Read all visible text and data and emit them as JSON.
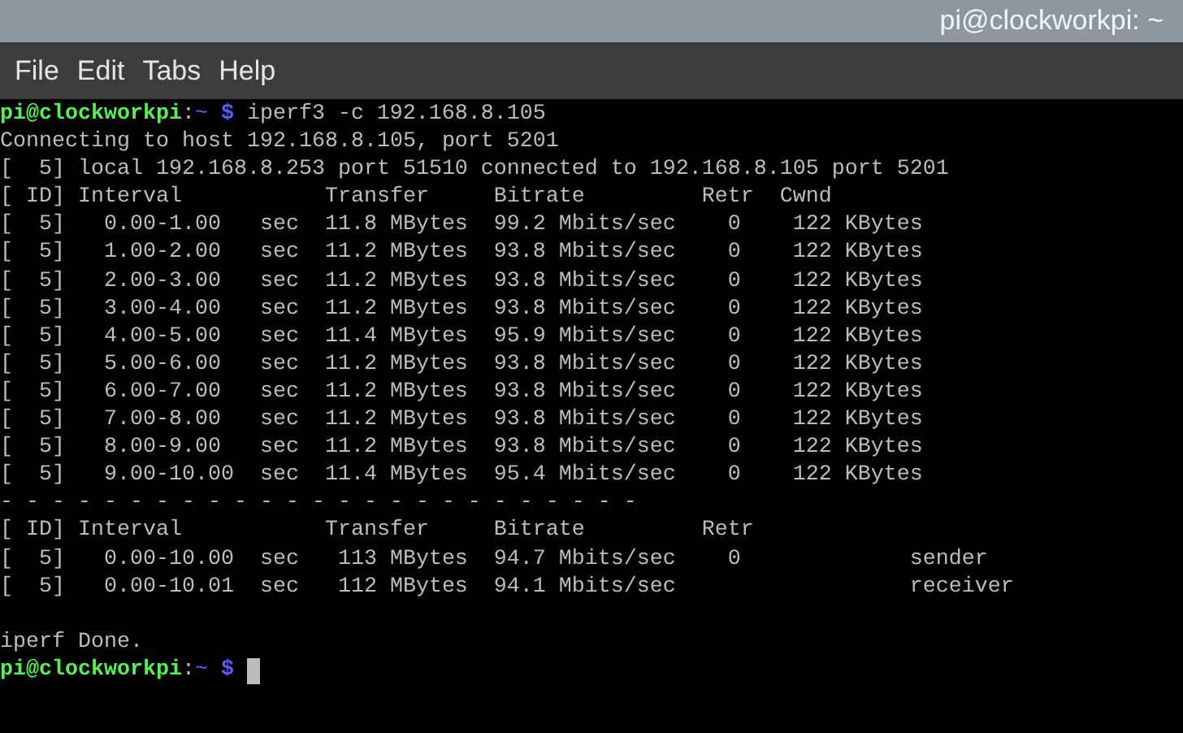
{
  "window": {
    "title": "pi@clockworkpi: ~"
  },
  "menu": [
    "File",
    "Edit",
    "Tabs",
    "Help"
  ],
  "terminal": {
    "lines": [
      {
        "kind": "prompt",
        "user": "pi@clockworkpi",
        "separator": ":",
        "path": "~",
        "symbol": "$",
        "command": "iperf3 -c 192.168.8.105"
      },
      {
        "kind": "output",
        "text": "Connecting to host 192.168.8.105, port 5201"
      },
      {
        "kind": "output",
        "text": "[  5] local 192.168.8.253 port 51510 connected to 192.168.8.105 port 5201"
      },
      {
        "kind": "output",
        "text": "[ ID] Interval           Transfer     Bitrate         Retr  Cwnd"
      },
      {
        "kind": "output",
        "text": "[  5]   0.00-1.00   sec  11.8 MBytes  99.2 Mbits/sec    0    122 KBytes"
      },
      {
        "kind": "output",
        "text": "[  5]   1.00-2.00   sec  11.2 MBytes  93.8 Mbits/sec    0    122 KBytes"
      },
      {
        "kind": "output",
        "text": "[  5]   2.00-3.00   sec  11.2 MBytes  93.8 Mbits/sec    0    122 KBytes"
      },
      {
        "kind": "output",
        "text": "[  5]   3.00-4.00   sec  11.2 MBytes  93.8 Mbits/sec    0    122 KBytes"
      },
      {
        "kind": "output",
        "text": "[  5]   4.00-5.00   sec  11.4 MBytes  95.9 Mbits/sec    0    122 KBytes"
      },
      {
        "kind": "output",
        "text": "[  5]   5.00-6.00   sec  11.2 MBytes  93.8 Mbits/sec    0    122 KBytes"
      },
      {
        "kind": "output",
        "text": "[  5]   6.00-7.00   sec  11.2 MBytes  93.8 Mbits/sec    0    122 KBytes"
      },
      {
        "kind": "output",
        "text": "[  5]   7.00-8.00   sec  11.2 MBytes  93.8 Mbits/sec    0    122 KBytes"
      },
      {
        "kind": "output",
        "text": "[  5]   8.00-9.00   sec  11.2 MBytes  93.8 Mbits/sec    0    122 KBytes"
      },
      {
        "kind": "output",
        "text": "[  5]   9.00-10.00  sec  11.4 MBytes  95.4 Mbits/sec    0    122 KBytes"
      },
      {
        "kind": "output",
        "text": "- - - - - - - - - - - - - - - - - - - - - - - - -"
      },
      {
        "kind": "output",
        "text": "[ ID] Interval           Transfer     Bitrate         Retr"
      },
      {
        "kind": "output",
        "text": "[  5]   0.00-10.00  sec   113 MBytes  94.7 Mbits/sec    0             sender"
      },
      {
        "kind": "output",
        "text": "[  5]   0.00-10.01  sec   112 MBytes  94.1 Mbits/sec                  receiver"
      },
      {
        "kind": "blank"
      },
      {
        "kind": "output",
        "text": "iperf Done."
      },
      {
        "kind": "prompt",
        "user": "pi@clockworkpi",
        "separator": ":",
        "path": "~",
        "symbol": "$",
        "cursor": true
      }
    ]
  }
}
